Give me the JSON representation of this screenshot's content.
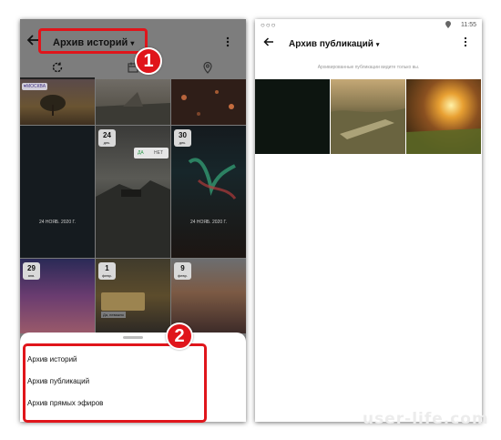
{
  "left_screen": {
    "header": {
      "title": "Архив историй",
      "chevron": "▾",
      "back_icon": "arrow-left-icon",
      "more_icon": "more-vertical-icon"
    },
    "tabs": [
      {
        "icon": "circle-refresh-icon",
        "active": true
      },
      {
        "icon": "calendar-icon",
        "active": false
      },
      {
        "icon": "map-pin-icon",
        "active": false
      }
    ],
    "stories": [
      {
        "location_sticker": "♥МОСКВА"
      },
      {},
      {},
      {
        "center_date": "24 НОЯБ. 2020 Г."
      },
      {
        "date_day": "24",
        "date_month": "дек.",
        "poll_yes": "ДА",
        "poll_no": "НЕТ"
      },
      {
        "date_day": "30",
        "date_month": "дек.",
        "center_date": "24 НОЯБ. 2020 Г."
      },
      {
        "date_day": "29",
        "date_month": "янв."
      },
      {
        "date_day": "1",
        "date_month": "февр.",
        "chip_text": "Да, неважно"
      },
      {
        "date_day": "9",
        "date_month": "февр."
      }
    ],
    "menu": {
      "items": [
        "Архив историй",
        "Архив публикаций",
        "Архив прямых эфиров"
      ]
    },
    "callouts": {
      "first": "1",
      "second": "2"
    }
  },
  "right_screen": {
    "status_bar": {
      "circles": "○○○",
      "time": "11:55",
      "location_icon": "location-icon"
    },
    "header": {
      "title": "Архив публикаций",
      "chevron": "▾",
      "back_icon": "arrow-left-icon",
      "more_icon": "more-vertical-icon"
    },
    "notice": "Архивированные публикации видите только вы.",
    "posts": [
      {
        "description": "dark"
      },
      {
        "description": "landscape"
      },
      {
        "description": "sunset grass"
      }
    ]
  },
  "watermark": "user-life.com",
  "colors": {
    "accent_red": "#e0151b",
    "dim_overlay": "#7a7a7a"
  }
}
